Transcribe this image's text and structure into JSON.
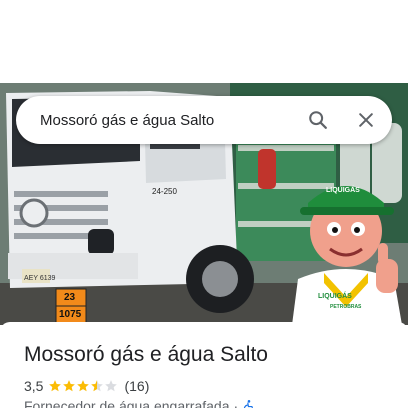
{
  "search": {
    "query": "Mossoró gás e água Salto"
  },
  "photo": {
    "truck_plate": "AEY 6139",
    "hazard_code_top": "23",
    "hazard_code_bottom": "1075",
    "cab_model": "24-250",
    "mascot_cap_logo": "LIQUIGÁS",
    "mascot_shirt_logo": "LIQUIGÁS",
    "mascot_shirt_sub": "PETROBRAS"
  },
  "place": {
    "name": "Mossoró gás e água Salto",
    "rating": "3,5",
    "rating_stars": 3.5,
    "review_count": "(16)",
    "category": "Fornecedor de água engarrafada",
    "separator": "·"
  },
  "colors": {
    "star_filled": "#fbbc04",
    "star_empty": "#dadce0",
    "accessibility": "#1a73e8"
  }
}
